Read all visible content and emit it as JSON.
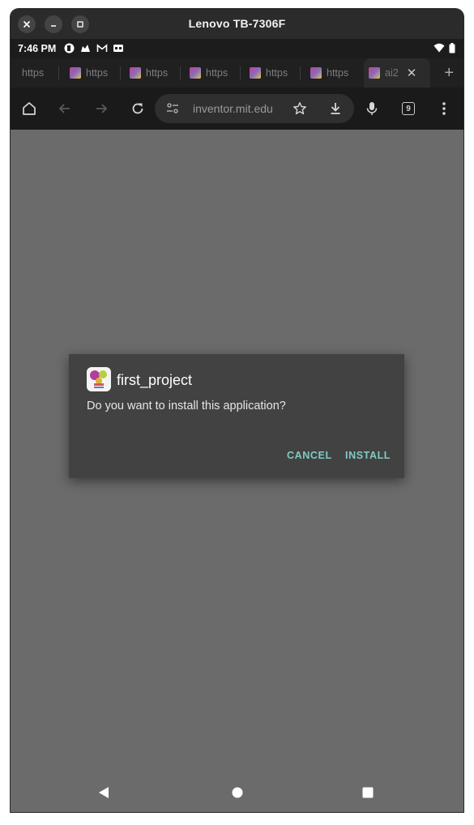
{
  "window": {
    "title": "Lenovo TB-7306F",
    "controls": [
      "close-icon",
      "minimize-icon",
      "maximize-icon"
    ]
  },
  "status_bar": {
    "time": "7:46 PM",
    "left_icons": [
      "app-icon",
      "notification-icon",
      "gmail-icon",
      "badge-icon"
    ],
    "right_icons": [
      "wifi-icon",
      "battery-icon"
    ]
  },
  "tabs": [
    {
      "label": "https"
    },
    {
      "label": "https"
    },
    {
      "label": "https"
    },
    {
      "label": "https"
    },
    {
      "label": "https"
    },
    {
      "label": "https"
    },
    {
      "label": "ai2",
      "active": true
    }
  ],
  "toolbar": {
    "url": "inventor.mit.edu",
    "tab_count": "9"
  },
  "dialog": {
    "app_name": "first_project",
    "message": "Do you want to install this application?",
    "cancel_label": "CANCEL",
    "install_label": "INSTALL",
    "accent_color": "#80cbc4"
  },
  "nav": [
    "back-icon",
    "home-icon",
    "recents-icon"
  ]
}
